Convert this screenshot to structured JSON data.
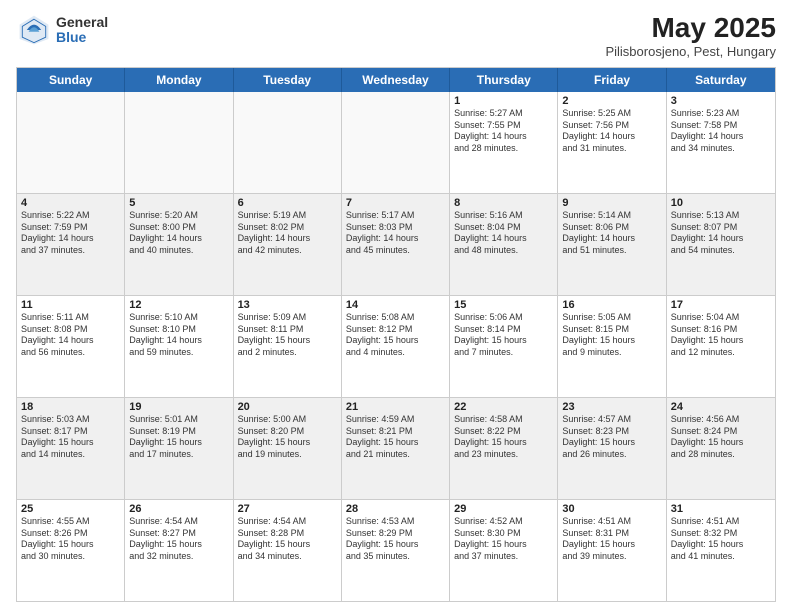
{
  "header": {
    "logo_line1": "General",
    "logo_line2": "Blue",
    "month_title": "May 2025",
    "location": "Pilisborosjeno, Pest, Hungary"
  },
  "weekdays": [
    "Sunday",
    "Monday",
    "Tuesday",
    "Wednesday",
    "Thursday",
    "Friday",
    "Saturday"
  ],
  "rows": [
    [
      {
        "day": "",
        "info": "",
        "empty": true
      },
      {
        "day": "",
        "info": "",
        "empty": true
      },
      {
        "day": "",
        "info": "",
        "empty": true
      },
      {
        "day": "",
        "info": "",
        "empty": true
      },
      {
        "day": "1",
        "info": "Sunrise: 5:27 AM\nSunset: 7:55 PM\nDaylight: 14 hours\nand 28 minutes.",
        "empty": false
      },
      {
        "day": "2",
        "info": "Sunrise: 5:25 AM\nSunset: 7:56 PM\nDaylight: 14 hours\nand 31 minutes.",
        "empty": false
      },
      {
        "day": "3",
        "info": "Sunrise: 5:23 AM\nSunset: 7:58 PM\nDaylight: 14 hours\nand 34 minutes.",
        "empty": false
      }
    ],
    [
      {
        "day": "4",
        "info": "Sunrise: 5:22 AM\nSunset: 7:59 PM\nDaylight: 14 hours\nand 37 minutes.",
        "empty": false
      },
      {
        "day": "5",
        "info": "Sunrise: 5:20 AM\nSunset: 8:00 PM\nDaylight: 14 hours\nand 40 minutes.",
        "empty": false
      },
      {
        "day": "6",
        "info": "Sunrise: 5:19 AM\nSunset: 8:02 PM\nDaylight: 14 hours\nand 42 minutes.",
        "empty": false
      },
      {
        "day": "7",
        "info": "Sunrise: 5:17 AM\nSunset: 8:03 PM\nDaylight: 14 hours\nand 45 minutes.",
        "empty": false
      },
      {
        "day": "8",
        "info": "Sunrise: 5:16 AM\nSunset: 8:04 PM\nDaylight: 14 hours\nand 48 minutes.",
        "empty": false
      },
      {
        "day": "9",
        "info": "Sunrise: 5:14 AM\nSunset: 8:06 PM\nDaylight: 14 hours\nand 51 minutes.",
        "empty": false
      },
      {
        "day": "10",
        "info": "Sunrise: 5:13 AM\nSunset: 8:07 PM\nDaylight: 14 hours\nand 54 minutes.",
        "empty": false
      }
    ],
    [
      {
        "day": "11",
        "info": "Sunrise: 5:11 AM\nSunset: 8:08 PM\nDaylight: 14 hours\nand 56 minutes.",
        "empty": false
      },
      {
        "day": "12",
        "info": "Sunrise: 5:10 AM\nSunset: 8:10 PM\nDaylight: 14 hours\nand 59 minutes.",
        "empty": false
      },
      {
        "day": "13",
        "info": "Sunrise: 5:09 AM\nSunset: 8:11 PM\nDaylight: 15 hours\nand 2 minutes.",
        "empty": false
      },
      {
        "day": "14",
        "info": "Sunrise: 5:08 AM\nSunset: 8:12 PM\nDaylight: 15 hours\nand 4 minutes.",
        "empty": false
      },
      {
        "day": "15",
        "info": "Sunrise: 5:06 AM\nSunset: 8:14 PM\nDaylight: 15 hours\nand 7 minutes.",
        "empty": false
      },
      {
        "day": "16",
        "info": "Sunrise: 5:05 AM\nSunset: 8:15 PM\nDaylight: 15 hours\nand 9 minutes.",
        "empty": false
      },
      {
        "day": "17",
        "info": "Sunrise: 5:04 AM\nSunset: 8:16 PM\nDaylight: 15 hours\nand 12 minutes.",
        "empty": false
      }
    ],
    [
      {
        "day": "18",
        "info": "Sunrise: 5:03 AM\nSunset: 8:17 PM\nDaylight: 15 hours\nand 14 minutes.",
        "empty": false
      },
      {
        "day": "19",
        "info": "Sunrise: 5:01 AM\nSunset: 8:19 PM\nDaylight: 15 hours\nand 17 minutes.",
        "empty": false
      },
      {
        "day": "20",
        "info": "Sunrise: 5:00 AM\nSunset: 8:20 PM\nDaylight: 15 hours\nand 19 minutes.",
        "empty": false
      },
      {
        "day": "21",
        "info": "Sunrise: 4:59 AM\nSunset: 8:21 PM\nDaylight: 15 hours\nand 21 minutes.",
        "empty": false
      },
      {
        "day": "22",
        "info": "Sunrise: 4:58 AM\nSunset: 8:22 PM\nDaylight: 15 hours\nand 23 minutes.",
        "empty": false
      },
      {
        "day": "23",
        "info": "Sunrise: 4:57 AM\nSunset: 8:23 PM\nDaylight: 15 hours\nand 26 minutes.",
        "empty": false
      },
      {
        "day": "24",
        "info": "Sunrise: 4:56 AM\nSunset: 8:24 PM\nDaylight: 15 hours\nand 28 minutes.",
        "empty": false
      }
    ],
    [
      {
        "day": "25",
        "info": "Sunrise: 4:55 AM\nSunset: 8:26 PM\nDaylight: 15 hours\nand 30 minutes.",
        "empty": false
      },
      {
        "day": "26",
        "info": "Sunrise: 4:54 AM\nSunset: 8:27 PM\nDaylight: 15 hours\nand 32 minutes.",
        "empty": false
      },
      {
        "day": "27",
        "info": "Sunrise: 4:54 AM\nSunset: 8:28 PM\nDaylight: 15 hours\nand 34 minutes.",
        "empty": false
      },
      {
        "day": "28",
        "info": "Sunrise: 4:53 AM\nSunset: 8:29 PM\nDaylight: 15 hours\nand 35 minutes.",
        "empty": false
      },
      {
        "day": "29",
        "info": "Sunrise: 4:52 AM\nSunset: 8:30 PM\nDaylight: 15 hours\nand 37 minutes.",
        "empty": false
      },
      {
        "day": "30",
        "info": "Sunrise: 4:51 AM\nSunset: 8:31 PM\nDaylight: 15 hours\nand 39 minutes.",
        "empty": false
      },
      {
        "day": "31",
        "info": "Sunrise: 4:51 AM\nSunset: 8:32 PM\nDaylight: 15 hours\nand 41 minutes.",
        "empty": false
      }
    ]
  ]
}
